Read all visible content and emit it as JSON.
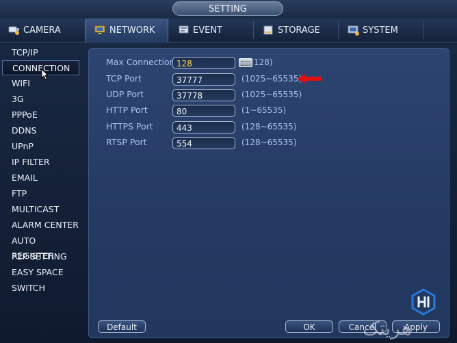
{
  "window": {
    "title": "SETTING"
  },
  "tabs": [
    {
      "label": "CAMERA",
      "icon": "camera-icon"
    },
    {
      "label": "NETWORK",
      "icon": "network-icon"
    },
    {
      "label": "EVENT",
      "icon": "event-icon"
    },
    {
      "label": "STORAGE",
      "icon": "storage-icon"
    },
    {
      "label": "SYSTEM",
      "icon": "system-icon"
    }
  ],
  "active_tab": "NETWORK",
  "sidemenu": {
    "items": [
      "TCP/IP",
      "CONNECTION",
      "WIFI",
      "3G",
      "PPPoE",
      "DDNS",
      "UPnP",
      "IP FILTER",
      "EMAIL",
      "FTP",
      "MULTICAST",
      "ALARM CENTER",
      "AUTO REGISTER",
      "P2P SETTING",
      "EASY SPACE",
      "SWITCH"
    ],
    "selected": "CONNECTION"
  },
  "connection": {
    "rows": [
      {
        "label": "Max Connection",
        "value": "128",
        "range": "128)"
      },
      {
        "label": "TCP Port",
        "value": "37777",
        "range": "(1025~65535)"
      },
      {
        "label": "UDP Port",
        "value": "37778",
        "range": "(1025~65535)"
      },
      {
        "label": "HTTP Port",
        "value": "80",
        "range": "(1~65535)"
      },
      {
        "label": "HTTPS Port",
        "value": "443",
        "range": "(128~65535)"
      },
      {
        "label": "RTSP Port",
        "value": "554",
        "range": "(128~65535)"
      }
    ]
  },
  "buttons": {
    "default": "Default",
    "ok": "OK",
    "cancel": "Cancel",
    "apply": "Apply"
  },
  "watermark": "هریتک",
  "colors": {
    "accent_yellow": "#ffd24a",
    "arrow_red": "#e01010",
    "label_blue": "#a9c4f0"
  }
}
